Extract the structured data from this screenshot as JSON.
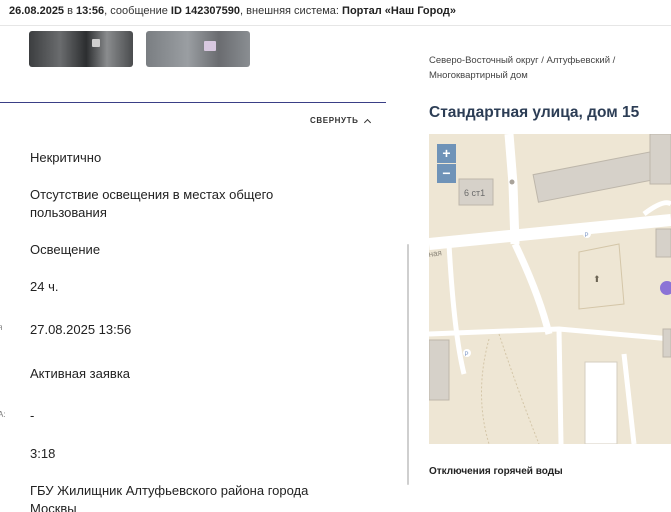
{
  "header": {
    "date": "26.08.2025",
    "time_prefix": "в",
    "time": "13:56",
    "message_prefix": "сообщение",
    "message_id": "ID 142307590",
    "system_prefix": "внешняя система:",
    "system_name": "Портал «Наш Город»"
  },
  "details": {
    "collapse_label": "СВЕРНУТЬ",
    "rows": [
      "Некритично",
      "Отсутствие освещения в местах общего пользования",
      "Освещение",
      "24 ч.",
      "27.08.2025 13:56",
      "Активная заявка",
      "-",
      "3:18",
      "ГБУ Жилищник Алтуфьевского района города Москвы"
    ],
    "cut_label_a": "я",
    "cut_label_b": "А:"
  },
  "location": {
    "breadcrumb": "Северо-Восточный округ / Алтуфьевский / Многоквартирный дом",
    "address": "Стандартная улица, дом 15",
    "map_building_label": "6 ст1",
    "map_street_label": "ная",
    "zoom_in": "+",
    "zoom_out": "−",
    "outage_title": "Отключения горячей воды"
  },
  "colors": {
    "accent_line": "#3a3f86",
    "zoom_button": "#6f93b8",
    "map_bg": "#eee6d4",
    "marker": "#8b73d6"
  }
}
